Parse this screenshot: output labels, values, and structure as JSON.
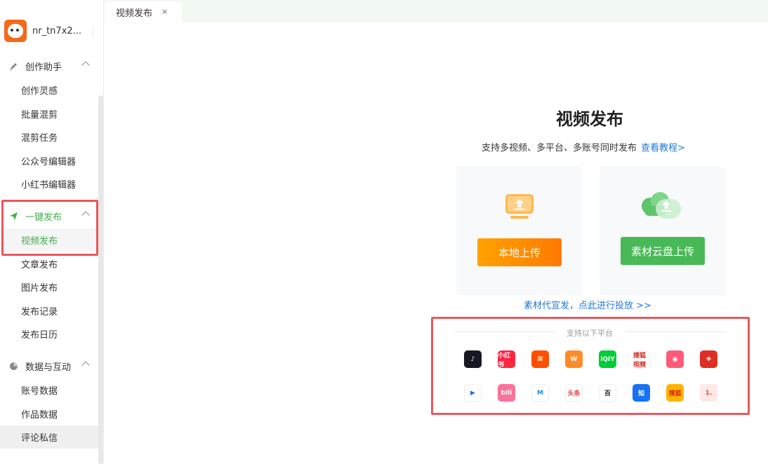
{
  "user": {
    "name": "nr_tn7x2..."
  },
  "sidebar": {
    "groups": [
      {
        "label": "创作助手",
        "icon": "pen-icon",
        "items": [
          "创作灵感",
          "批量混剪",
          "混剪任务",
          "公众号编辑器",
          "小红书编辑器"
        ]
      },
      {
        "label": "一键发布",
        "icon": "paper-plane-icon",
        "items": [
          "视频发布",
          "文章发布",
          "图片发布",
          "发布记录",
          "发布日历"
        ]
      },
      {
        "label": "数据与互动",
        "icon": "pie-chart-icon",
        "items": [
          "账号数据",
          "作品数据",
          "评论私信"
        ]
      }
    ],
    "active_item": "视频发布"
  },
  "tabs": [
    {
      "label": "视频发布",
      "close": "×"
    }
  ],
  "main": {
    "title": "视频发布",
    "subtitle": "支持多视频、多平台、多账号同时发布",
    "tutorial_link": "查看教程>",
    "local_upload_label": "本地上传",
    "cloud_upload_label": "素材云盘上传",
    "promo_link": "素材代宣发，点此进行投放 >>",
    "platforms_label": "支持以下平台"
  },
  "colors": {
    "accent": "#3fae4a",
    "link": "#1e7bd8",
    "highlight": "#e8585d",
    "orange": "#ff8a00"
  },
  "platforms": [
    {
      "name": "douyin",
      "text": "♪",
      "bg": "#161823",
      "fg": "#ffffff"
    },
    {
      "name": "xiaohongshu",
      "text": "小红书",
      "bg": "#ff2442",
      "fg": "#ffffff"
    },
    {
      "name": "kuaishou",
      "text": "⌘",
      "bg": "#ff5000",
      "fg": "#ffffff"
    },
    {
      "name": "weishi",
      "text": "W",
      "bg": "#ff8c28",
      "fg": "#ffffff"
    },
    {
      "name": "iqiyi",
      "text": "iQIY",
      "bg": "#00cc36",
      "fg": "#ffffff"
    },
    {
      "name": "sohu-video",
      "text": "搜狐视频",
      "bg": "#ffffff",
      "fg": "#d8251d"
    },
    {
      "name": "pipixia",
      "text": "◉",
      "bg": "#ff5a7a",
      "fg": "#ffffff"
    },
    {
      "name": "pinduoduo",
      "text": "❖",
      "bg": "#e02e24",
      "fg": "#ffffff"
    },
    {
      "name": "haokan",
      "text": "▶",
      "bg": "#ffffff",
      "fg": "#2d6ee0"
    },
    {
      "name": "bilibili",
      "text": "bili",
      "bg": "#fb7299",
      "fg": "#ffffff"
    },
    {
      "name": "xigua",
      "text": "M",
      "bg": "#ffffff",
      "fg": "#1a8fe3"
    },
    {
      "name": "toutiao",
      "text": "头条",
      "bg": "#ffffff",
      "fg": "#f04142"
    },
    {
      "name": "baijiahao",
      "text": "百",
      "bg": "#ffffff",
      "fg": "#222222"
    },
    {
      "name": "zhihu",
      "text": "知",
      "bg": "#1772f6",
      "fg": "#ffffff"
    },
    {
      "name": "sohu-hao",
      "text": "搜狐",
      "bg": "#ffb400",
      "fg": "#d8251d"
    },
    {
      "name": "kuaiyixia",
      "text": "1.",
      "bg": "#ffe9e6",
      "fg": "#e8483a"
    }
  ]
}
